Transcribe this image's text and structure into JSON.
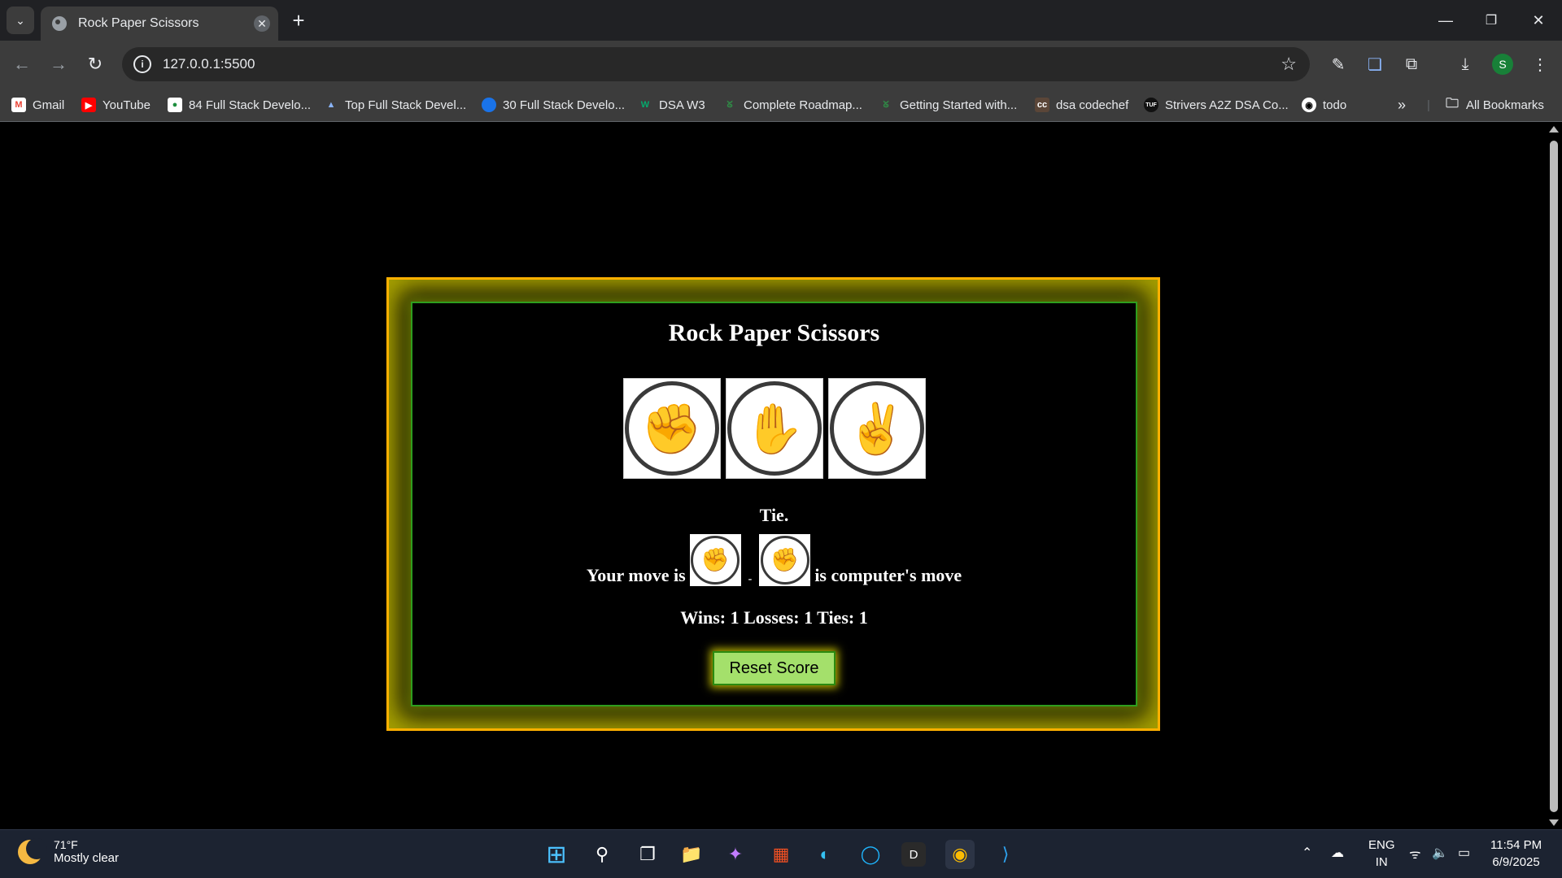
{
  "browser": {
    "tab_title": "Rock Paper Scissors",
    "url": "127.0.0.1:5500",
    "bookmarks": [
      {
        "label": "Gmail",
        "icon": "gmail-icon",
        "color": "#ea4335"
      },
      {
        "label": "YouTube",
        "icon": "youtube-icon",
        "color": "#ff0000"
      },
      {
        "label": "84 Full Stack Develo...",
        "icon": "bookmark-site-icon",
        "color": "#1e8e3e"
      },
      {
        "label": "Top Full Stack Devel...",
        "icon": "mountain-icon",
        "color": "#8ab4f8"
      },
      {
        "label": "30 Full Stack Develo...",
        "icon": "blue-circle-icon",
        "color": "#1a73e8"
      },
      {
        "label": "DSA W3",
        "icon": "w3-icon",
        "color": "#04aa6d"
      },
      {
        "label": "Complete Roadmap...",
        "icon": "gfg-icon",
        "color": "#2f8d46"
      },
      {
        "label": "Getting Started with...",
        "icon": "gfg-icon",
        "color": "#2f8d46"
      },
      {
        "label": "dsa codechef",
        "icon": "codechef-icon",
        "color": "#5b4638"
      },
      {
        "label": "Strivers A2Z DSA Co...",
        "icon": "tuf-icon",
        "color": "#111111"
      },
      {
        "label": "todo",
        "icon": "github-icon",
        "color": "#ffffff"
      }
    ],
    "all_bookmarks": "All Bookmarks",
    "profile_initial": "S"
  },
  "game": {
    "title": "Rock Paper Scissors",
    "choices": [
      {
        "name": "rock",
        "glyph": "✊"
      },
      {
        "name": "paper",
        "glyph": "✋"
      },
      {
        "name": "scissors",
        "glyph": "✌"
      }
    ],
    "result": "Tie.",
    "your_move_label": "Your move is",
    "separator": "-",
    "computer_move_label": "is computer's move",
    "player_move_glyph": "✊",
    "computer_move_glyph": "✊",
    "score_text": "Wins: 1 Losses: 1 Ties: 1",
    "reset_label": "Reset Score"
  },
  "taskbar": {
    "temperature": "71°F",
    "weather": "Mostly clear",
    "lang_1": "ENG",
    "lang_2": "IN",
    "time": "11:54 PM",
    "date": "6/9/2025"
  }
}
